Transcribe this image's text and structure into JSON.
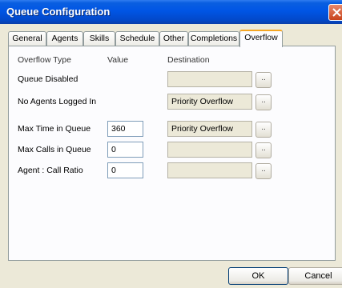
{
  "window": {
    "title": "Queue Configuration"
  },
  "tabs": [
    {
      "label": "General",
      "active": false
    },
    {
      "label": "Agents",
      "active": false
    },
    {
      "label": "Skills",
      "active": false
    },
    {
      "label": "Schedule",
      "active": false
    },
    {
      "label": "Other",
      "active": false
    },
    {
      "label": "Completions",
      "active": false
    },
    {
      "label": "Overflow",
      "active": true
    }
  ],
  "overflow": {
    "headers": {
      "type": "Overflow Type",
      "value": "Value",
      "destination": "Destination"
    },
    "rows": [
      {
        "label": "Queue Disabled",
        "value": null,
        "destination": ""
      },
      {
        "label": "No Agents Logged In",
        "value": null,
        "destination": "Priority Overflow"
      },
      {
        "label": "Max Time in Queue",
        "value": "360",
        "destination": "Priority Overflow"
      },
      {
        "label": "Max Calls in Queue",
        "value": "0",
        "destination": ""
      },
      {
        "label": "Agent : Call Ratio",
        "value": "0",
        "destination": ""
      }
    ],
    "browse_label": ".."
  },
  "buttons": {
    "ok": "OK",
    "cancel": "Cancel"
  },
  "icons": {
    "close": "close-icon"
  },
  "colors": {
    "title_bar": "#0055e5",
    "dialog_bg": "#ECE9D8",
    "active_tab_accent": "#f5a623"
  }
}
